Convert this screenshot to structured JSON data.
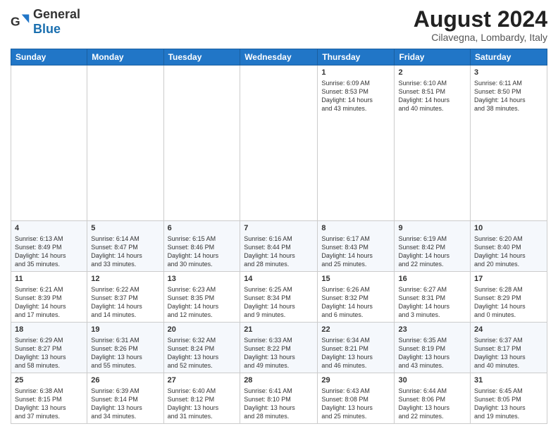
{
  "header": {
    "logo_general": "General",
    "logo_blue": "Blue",
    "month_year": "August 2024",
    "location": "Cilavegna, Lombardy, Italy"
  },
  "days_of_week": [
    "Sunday",
    "Monday",
    "Tuesday",
    "Wednesday",
    "Thursday",
    "Friday",
    "Saturday"
  ],
  "weeks": [
    {
      "days": [
        {
          "number": "",
          "info": ""
        },
        {
          "number": "",
          "info": ""
        },
        {
          "number": "",
          "info": ""
        },
        {
          "number": "",
          "info": ""
        },
        {
          "number": "1",
          "info": "Sunrise: 6:09 AM\nSunset: 8:53 PM\nDaylight: 14 hours\nand 43 minutes."
        },
        {
          "number": "2",
          "info": "Sunrise: 6:10 AM\nSunset: 8:51 PM\nDaylight: 14 hours\nand 40 minutes."
        },
        {
          "number": "3",
          "info": "Sunrise: 6:11 AM\nSunset: 8:50 PM\nDaylight: 14 hours\nand 38 minutes."
        }
      ]
    },
    {
      "days": [
        {
          "number": "4",
          "info": "Sunrise: 6:13 AM\nSunset: 8:49 PM\nDaylight: 14 hours\nand 35 minutes."
        },
        {
          "number": "5",
          "info": "Sunrise: 6:14 AM\nSunset: 8:47 PM\nDaylight: 14 hours\nand 33 minutes."
        },
        {
          "number": "6",
          "info": "Sunrise: 6:15 AM\nSunset: 8:46 PM\nDaylight: 14 hours\nand 30 minutes."
        },
        {
          "number": "7",
          "info": "Sunrise: 6:16 AM\nSunset: 8:44 PM\nDaylight: 14 hours\nand 28 minutes."
        },
        {
          "number": "8",
          "info": "Sunrise: 6:17 AM\nSunset: 8:43 PM\nDaylight: 14 hours\nand 25 minutes."
        },
        {
          "number": "9",
          "info": "Sunrise: 6:19 AM\nSunset: 8:42 PM\nDaylight: 14 hours\nand 22 minutes."
        },
        {
          "number": "10",
          "info": "Sunrise: 6:20 AM\nSunset: 8:40 PM\nDaylight: 14 hours\nand 20 minutes."
        }
      ]
    },
    {
      "days": [
        {
          "number": "11",
          "info": "Sunrise: 6:21 AM\nSunset: 8:39 PM\nDaylight: 14 hours\nand 17 minutes."
        },
        {
          "number": "12",
          "info": "Sunrise: 6:22 AM\nSunset: 8:37 PM\nDaylight: 14 hours\nand 14 minutes."
        },
        {
          "number": "13",
          "info": "Sunrise: 6:23 AM\nSunset: 8:35 PM\nDaylight: 14 hours\nand 12 minutes."
        },
        {
          "number": "14",
          "info": "Sunrise: 6:25 AM\nSunset: 8:34 PM\nDaylight: 14 hours\nand 9 minutes."
        },
        {
          "number": "15",
          "info": "Sunrise: 6:26 AM\nSunset: 8:32 PM\nDaylight: 14 hours\nand 6 minutes."
        },
        {
          "number": "16",
          "info": "Sunrise: 6:27 AM\nSunset: 8:31 PM\nDaylight: 14 hours\nand 3 minutes."
        },
        {
          "number": "17",
          "info": "Sunrise: 6:28 AM\nSunset: 8:29 PM\nDaylight: 14 hours\nand 0 minutes."
        }
      ]
    },
    {
      "days": [
        {
          "number": "18",
          "info": "Sunrise: 6:29 AM\nSunset: 8:27 PM\nDaylight: 13 hours\nand 58 minutes."
        },
        {
          "number": "19",
          "info": "Sunrise: 6:31 AM\nSunset: 8:26 PM\nDaylight: 13 hours\nand 55 minutes."
        },
        {
          "number": "20",
          "info": "Sunrise: 6:32 AM\nSunset: 8:24 PM\nDaylight: 13 hours\nand 52 minutes."
        },
        {
          "number": "21",
          "info": "Sunrise: 6:33 AM\nSunset: 8:22 PM\nDaylight: 13 hours\nand 49 minutes."
        },
        {
          "number": "22",
          "info": "Sunrise: 6:34 AM\nSunset: 8:21 PM\nDaylight: 13 hours\nand 46 minutes."
        },
        {
          "number": "23",
          "info": "Sunrise: 6:35 AM\nSunset: 8:19 PM\nDaylight: 13 hours\nand 43 minutes."
        },
        {
          "number": "24",
          "info": "Sunrise: 6:37 AM\nSunset: 8:17 PM\nDaylight: 13 hours\nand 40 minutes."
        }
      ]
    },
    {
      "days": [
        {
          "number": "25",
          "info": "Sunrise: 6:38 AM\nSunset: 8:15 PM\nDaylight: 13 hours\nand 37 minutes."
        },
        {
          "number": "26",
          "info": "Sunrise: 6:39 AM\nSunset: 8:14 PM\nDaylight: 13 hours\nand 34 minutes."
        },
        {
          "number": "27",
          "info": "Sunrise: 6:40 AM\nSunset: 8:12 PM\nDaylight: 13 hours\nand 31 minutes."
        },
        {
          "number": "28",
          "info": "Sunrise: 6:41 AM\nSunset: 8:10 PM\nDaylight: 13 hours\nand 28 minutes."
        },
        {
          "number": "29",
          "info": "Sunrise: 6:43 AM\nSunset: 8:08 PM\nDaylight: 13 hours\nand 25 minutes."
        },
        {
          "number": "30",
          "info": "Sunrise: 6:44 AM\nSunset: 8:06 PM\nDaylight: 13 hours\nand 22 minutes."
        },
        {
          "number": "31",
          "info": "Sunrise: 6:45 AM\nSunset: 8:05 PM\nDaylight: 13 hours\nand 19 minutes."
        }
      ]
    }
  ]
}
